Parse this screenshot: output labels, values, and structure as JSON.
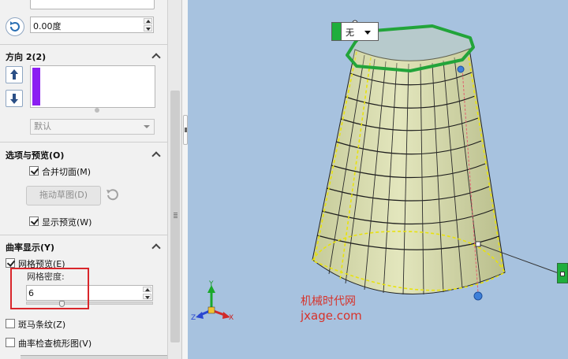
{
  "angle_field": {
    "value": "0.00度"
  },
  "direction2": {
    "title": "方向 2(2)",
    "dropdown_value": "默认"
  },
  "options_section": {
    "title": "选项与预览(O)",
    "merge_faces": {
      "label": "合并切面(M)",
      "checked": true
    },
    "drag_sketch": {
      "label": "拖动草图(D)"
    },
    "show_preview": {
      "label": "显示预览(W)",
      "checked": true
    }
  },
  "curvature_section": {
    "title": "曲率显示(Y)",
    "mesh_preview": {
      "label": "网格预览(E)",
      "checked": true
    },
    "mesh_density": {
      "label": "网格密度:",
      "value": "6"
    },
    "zebra": {
      "label": "斑马条纹(Z)",
      "checked": false
    },
    "curvature_comb": {
      "label": "曲率检查梳形图(V)",
      "checked": false
    }
  },
  "viewport": {
    "callout_value": "无",
    "triad": {
      "x": "X",
      "y": "Y",
      "z": "Z"
    },
    "watermark_line1": "机械时代网",
    "watermark_line2": "jxage.com"
  },
  "colors": {
    "viewport_bg": "#a7c2df",
    "surface": "#d3d8a6",
    "selection_green": "#22a43a",
    "direction_swatch": "#8b1ef2",
    "highlight_box": "#d9262b"
  }
}
